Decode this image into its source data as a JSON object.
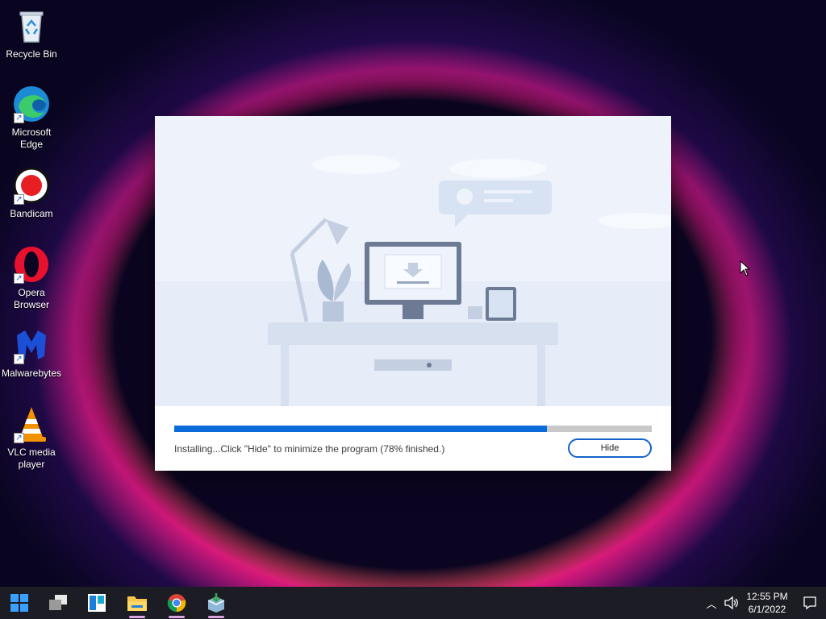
{
  "desktop": {
    "icons": [
      {
        "label": "Recycle Bin",
        "icon": "recycle-bin-icon"
      },
      {
        "label": "Microsoft Edge",
        "icon": "edge-icon"
      },
      {
        "label": "Bandicam",
        "icon": "bandicam-icon"
      },
      {
        "label": "Opera Browser",
        "icon": "opera-icon"
      },
      {
        "label": "Malwarebytes",
        "icon": "malwarebytes-icon"
      },
      {
        "label": "VLC media player",
        "icon": "vlc-icon"
      }
    ]
  },
  "installer": {
    "progress_percent": 78,
    "status": "Installing...Click \"Hide\" to minimize the program (78% finished.)",
    "hide_label": "Hide"
  },
  "taskbar": {
    "apps": [
      "start-icon",
      "task-view-icon",
      "widgets-icon",
      "file-explorer-icon",
      "chrome-icon",
      "installer-app-icon"
    ],
    "time": "12:55 PM",
    "date": "6/1/2022"
  },
  "colors": {
    "accent": "#0a6cd8",
    "taskbar": "#1c1c24",
    "progress_track": "#c8c8c8"
  }
}
